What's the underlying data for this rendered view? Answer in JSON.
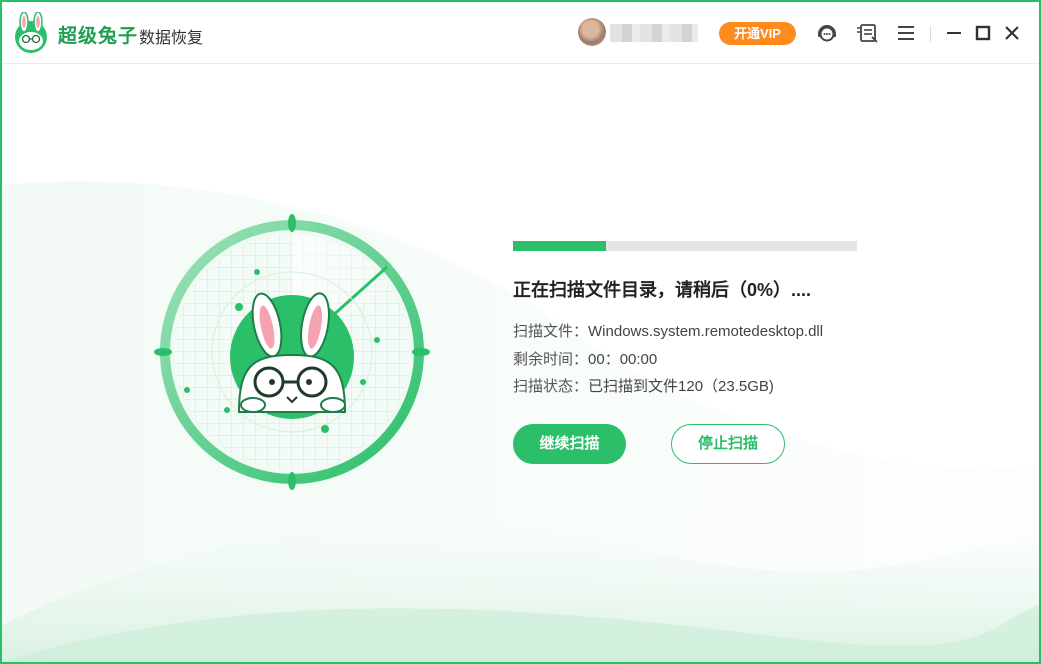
{
  "app": {
    "brand_name": "超级兔子",
    "brand_sub": "数据恢复",
    "vip_label": "开通VIP"
  },
  "titlebar_icons": [
    "support-icon",
    "feedback-icon",
    "menu-icon",
    "minimize-icon",
    "maximize-icon",
    "close-icon"
  ],
  "scan": {
    "progress_percent": 27,
    "status_title": "正在扫描文件目录，请稍后（0%）....",
    "file_label": "扫描文件：",
    "file_value": "Windows.system.remotedesktop.dll",
    "remaining_label": "剩余时间：",
    "remaining_value": "00：00:00",
    "state_label": "扫描状态：",
    "state_value": "已扫描到文件120（23.5GB)"
  },
  "buttons": {
    "continue_label": "继续扫描",
    "stop_label": "停止扫描"
  },
  "colors": {
    "accent": "#2bbf6a",
    "vip": "#ff8a1e",
    "track": "#e5e5e5"
  }
}
